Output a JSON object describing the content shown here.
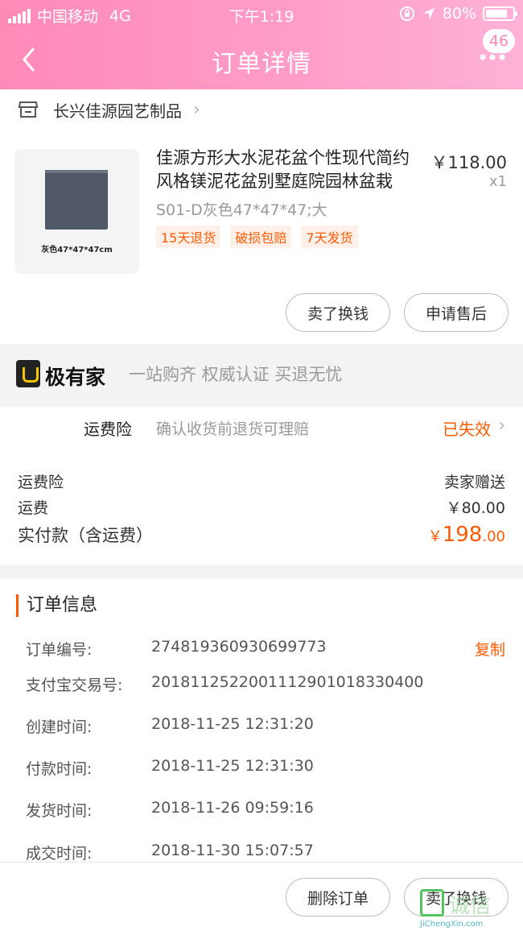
{
  "status_bar": {
    "carrier": "中国移动",
    "network": "4G",
    "time": "下午1:19",
    "battery": "80%",
    "battery_level": 0.8
  },
  "nav": {
    "title": "订单详情",
    "badge": "46"
  },
  "shop": {
    "name": "长兴佳源园艺制品"
  },
  "product": {
    "image_caption": "灰色47*47*47cm",
    "title": "佳源方形大水泥花盆个性现代简约风格镁泥花盆别墅庭院园林盆栽",
    "price": "￥118.00",
    "qty": "x1",
    "sku": "S01-D灰色47*47*47;大",
    "tags": [
      "15天退货",
      "破损包赔",
      "7天发货"
    ],
    "buttons": {
      "sell": "卖了换钱",
      "after_sale": "申请售后"
    }
  },
  "jiyoujia": {
    "brand": "极有家",
    "slogan": "一站购齐 权威认证 买退无忧"
  },
  "insurance": {
    "label": "运费险",
    "desc": "确认收货前退货可理赔",
    "status": "已失效"
  },
  "summary": {
    "insurance_label": "运费险",
    "insurance_value": "卖家赠送",
    "shipping_label": "运费",
    "shipping_value": "￥80.00",
    "total_label": "实付款（含运费）",
    "total_currency": "￥",
    "total_int": "198",
    "total_dec": ".00"
  },
  "order_info": {
    "title": "订单信息",
    "copy_label": "复制",
    "rows": [
      {
        "k": "订单编号:",
        "v": "274819360930699773"
      },
      {
        "k": "支付宝交易号:",
        "v": "2018112522001112901018330400"
      },
      {
        "k": "创建时间:",
        "v": "2018-11-25 12:31:20"
      },
      {
        "k": "付款时间:",
        "v": "2018-11-25 12:31:30"
      },
      {
        "k": "发货时间:",
        "v": "2018-11-26 09:59:16"
      },
      {
        "k": "成交时间:",
        "v": "2018-11-30 15:07:57"
      }
    ]
  },
  "bottom": {
    "delete": "删除订单",
    "sell": "卖了换钱"
  },
  "watermark": {
    "text": "诚信",
    "url": "JiChengXin.com"
  },
  "colors": {
    "accent": "#ff5a00",
    "header": "#ff9cc8"
  }
}
